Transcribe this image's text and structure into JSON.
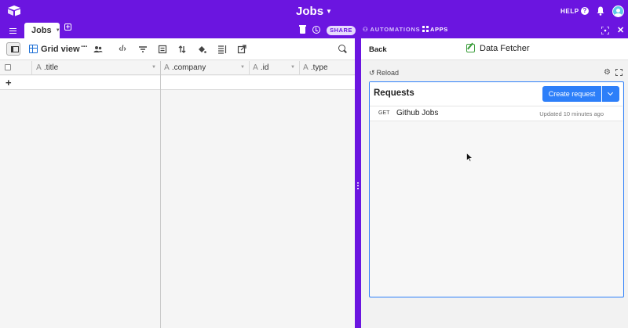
{
  "topbar": {
    "base_name": "Jobs",
    "help_label": "HELP",
    "help_icon_glyph": "?"
  },
  "tabbar": {
    "table_tab": "Jobs",
    "share_label": "SHARE",
    "automations_label": "AUTOMATIONS",
    "apps_label": "APPS"
  },
  "toolbar": {
    "view_name": "Grid view",
    "more_glyph": "···"
  },
  "grid": {
    "columns": [
      {
        "name": ".title",
        "type_glyph": "A"
      },
      {
        "name": ".company",
        "type_glyph": "A"
      },
      {
        "name": ".id",
        "type_glyph": "A"
      },
      {
        "name": ".type",
        "type_glyph": "A"
      }
    ],
    "add_row_glyph": "+"
  },
  "panel": {
    "back_label": "Back",
    "app_title": "Data Fetcher",
    "reload_label": "Reload",
    "requests_title": "Requests",
    "create_button": "Create request",
    "requests": [
      {
        "method": "GET",
        "name": "Github Jobs",
        "updated": "Updated 10 minutes ago"
      }
    ]
  },
  "colors": {
    "brand_purple": "#6b15e0",
    "primary_blue": "#2d7ff9",
    "grid_view_icon": "#1a6dd4",
    "app_icon_green": "#3a9d3a"
  },
  "icons": [
    "logo-icon",
    "menu-icon",
    "add-tab-icon",
    "trash-icon",
    "history-icon",
    "automations-icon",
    "apps-icon",
    "expand-icon",
    "close-icon",
    "help-icon",
    "bell-icon",
    "avatar",
    "sidebar-toggle-icon",
    "grid-view-icon",
    "people-icon",
    "code-icon",
    "filter-icon",
    "group-icon",
    "sort-icon",
    "color-icon",
    "row-height-icon",
    "share-view-icon",
    "search-icon",
    "reload-icon",
    "settings-icon",
    "fullscreen-icon",
    "data-fetcher-icon",
    "chevron-down-icon",
    "cursor-icon"
  ]
}
